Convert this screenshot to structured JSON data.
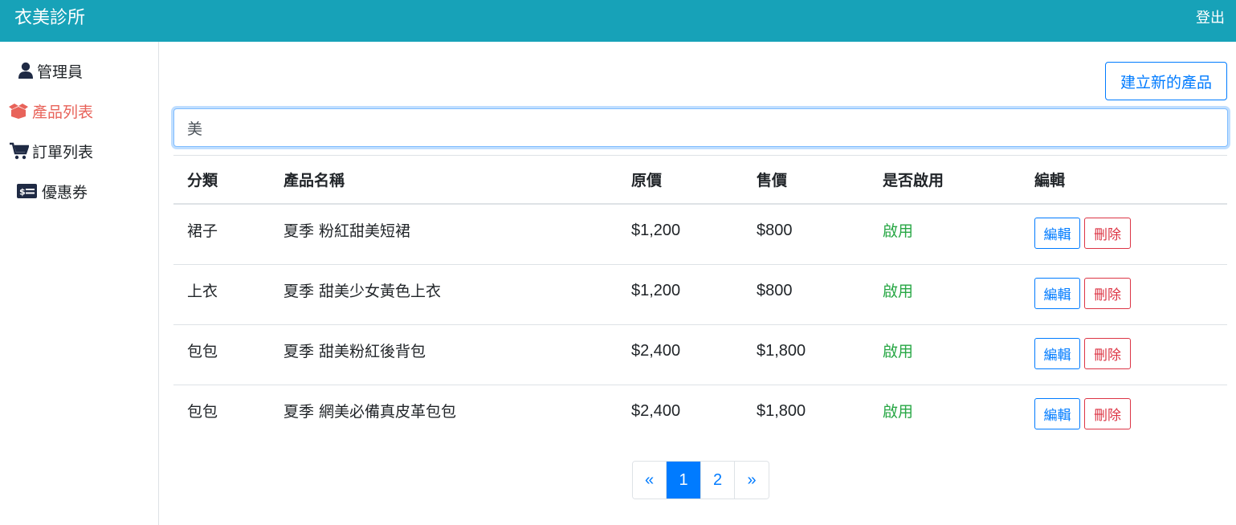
{
  "app": {
    "brand": "衣美診所",
    "logout": "登出"
  },
  "colors": {
    "navbar": "#17a2b8",
    "accent": "#007bff",
    "active_nav": "#e8635a",
    "enabled": "#28a745",
    "danger": "#dc3545"
  },
  "sidebar": {
    "items": [
      {
        "label": "管理員",
        "icon": "user-icon"
      },
      {
        "label": "產品列表",
        "icon": "box-open-icon",
        "active": true
      },
      {
        "label": "訂單列表",
        "icon": "shopping-cart-icon"
      },
      {
        "label": "優惠券",
        "icon": "money-check-icon"
      }
    ]
  },
  "toolbar": {
    "create_label": "建立新的產品"
  },
  "search": {
    "value": "美"
  },
  "table": {
    "headers": [
      "分類",
      "產品名稱",
      "原價",
      "售價",
      "是否啟用",
      "編輯"
    ],
    "rows": [
      {
        "category": "裙子",
        "name": "夏季 粉紅甜美短裙",
        "origin_price": "$1,200",
        "price": "$800",
        "status": "啟用"
      },
      {
        "category": "上衣",
        "name": "夏季 甜美少女黃色上衣",
        "origin_price": "$1,200",
        "price": "$800",
        "status": "啟用"
      },
      {
        "category": "包包",
        "name": "夏季 甜美粉紅後背包",
        "origin_price": "$2,400",
        "price": "$1,800",
        "status": "啟用"
      },
      {
        "category": "包包",
        "name": "夏季 網美必備真皮革包包",
        "origin_price": "$2,400",
        "price": "$1,800",
        "status": "啟用"
      }
    ],
    "edit_label": "編輯",
    "delete_label": "刪除"
  },
  "pagination": {
    "prev": "«",
    "pages": [
      "1",
      "2"
    ],
    "current": "1",
    "next": "»"
  }
}
